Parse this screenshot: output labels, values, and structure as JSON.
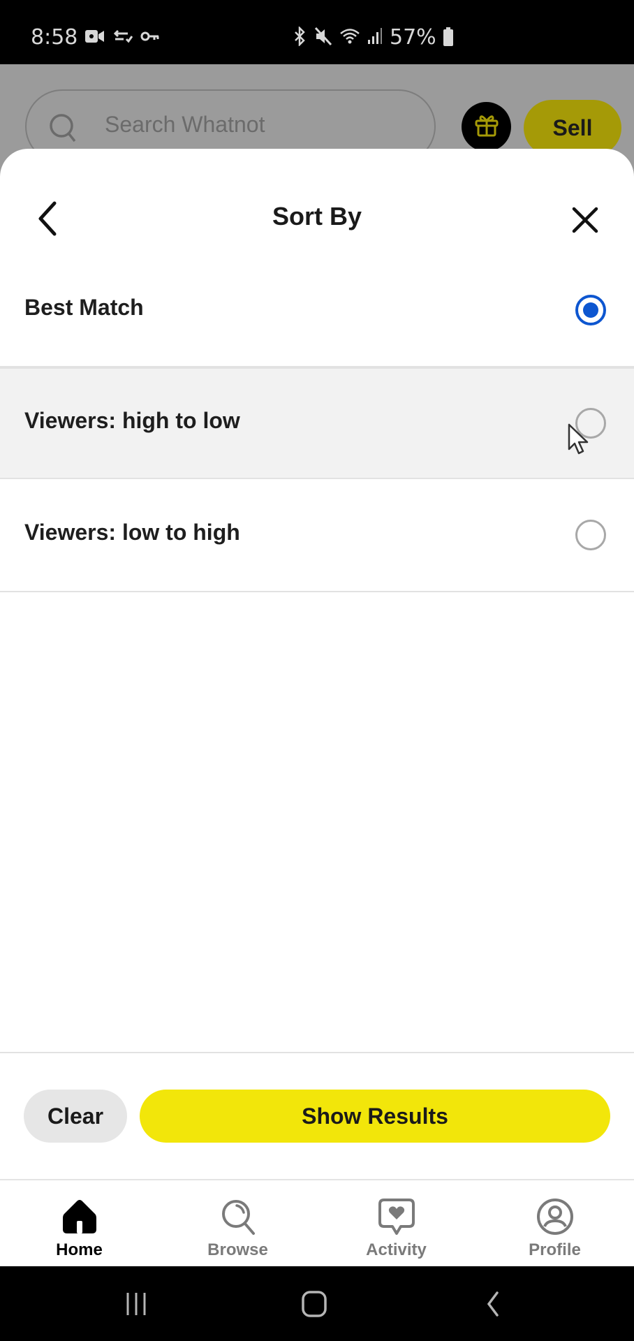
{
  "status_bar": {
    "time": "8:58",
    "left_icons": [
      "video-camera-icon",
      "cloud-sync-icon",
      "key-icon"
    ],
    "right_icons": [
      "bluetooth-icon",
      "mute-icon",
      "wifi-icon",
      "signal-icon"
    ],
    "battery_percent": "57%"
  },
  "background_header": {
    "search_placeholder": "Search Whatnot",
    "gift_icon": "gift-icon",
    "sell_label": "Sell"
  },
  "sheet": {
    "title": "Sort By",
    "back_icon": "chevron-left-icon",
    "close_icon": "close-icon",
    "options": [
      {
        "label": "Best Match",
        "selected": true
      },
      {
        "label": "Viewers: high to low",
        "selected": false
      },
      {
        "label": "Viewers: low to high",
        "selected": false
      }
    ],
    "clear_label": "Clear",
    "show_results_label": "Show Results"
  },
  "bottom_nav": {
    "items": [
      {
        "label": "Home",
        "icon": "home-icon",
        "active": true
      },
      {
        "label": "Browse",
        "icon": "browse-icon",
        "active": false
      },
      {
        "label": "Activity",
        "icon": "activity-icon",
        "active": false
      },
      {
        "label": "Profile",
        "icon": "profile-icon",
        "active": false
      }
    ]
  },
  "colors": {
    "accent_blue": "#0d56d0",
    "brand_yellow": "#f2e60a",
    "dimmed_yellow": "#a59a07"
  }
}
